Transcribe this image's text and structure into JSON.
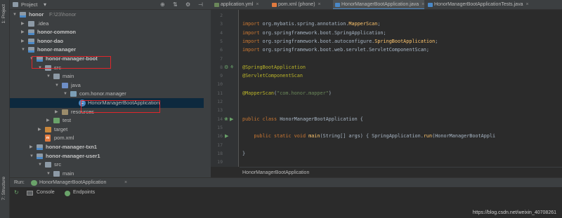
{
  "sidebar": {
    "project_tab": "1: Project",
    "structure_tab": "7: Structure"
  },
  "project_panel": {
    "title": "Project",
    "tree": [
      {
        "label": "honor",
        "extra": "F:\\23\\honor",
        "level": 0,
        "expanded": true,
        "icon": "folder-module",
        "bold": true
      },
      {
        "label": ".idea",
        "level": 1,
        "expanded": false,
        "icon": "folder"
      },
      {
        "label": "honor-common",
        "level": 1,
        "expanded": false,
        "icon": "folder-module",
        "bold": true
      },
      {
        "label": "honor-dao",
        "level": 1,
        "expanded": false,
        "icon": "folder-module",
        "bold": true
      },
      {
        "label": "honor-manager",
        "level": 1,
        "expanded": true,
        "icon": "folder-module",
        "bold": true
      },
      {
        "label": "honor-manager-boot",
        "level": 2,
        "expanded": true,
        "icon": "folder-module",
        "bold": true,
        "highlight": true
      },
      {
        "label": "src",
        "level": 3,
        "expanded": true,
        "icon": "folder"
      },
      {
        "label": "main",
        "level": 4,
        "expanded": true,
        "icon": "folder"
      },
      {
        "label": "java",
        "level": 5,
        "expanded": true,
        "icon": "folder-src"
      },
      {
        "label": "com.honor.manager",
        "level": 6,
        "expanded": true,
        "icon": "package"
      },
      {
        "label": "HonorManagerBootApplication",
        "level": 7,
        "icon": "class",
        "selected": true,
        "highlight": true
      },
      {
        "label": "resources",
        "level": 5,
        "expanded": false,
        "icon": "folder-res"
      },
      {
        "label": "test",
        "level": 4,
        "expanded": false,
        "icon": "folder-test"
      },
      {
        "label": "target",
        "level": 3,
        "expanded": false,
        "icon": "folder-orange"
      },
      {
        "label": "pom.xml",
        "level": 3,
        "icon": "xml"
      },
      {
        "label": "honor-manager-txn1",
        "level": 2,
        "expanded": false,
        "icon": "folder-module",
        "bold": true
      },
      {
        "label": "honor-manager-user1",
        "level": 2,
        "expanded": true,
        "icon": "folder-module",
        "bold": true
      },
      {
        "label": "src",
        "level": 3,
        "expanded": true,
        "icon": "folder"
      },
      {
        "label": "main",
        "level": 4,
        "expanded": true,
        "icon": "folder"
      },
      {
        "label": "java",
        "level": 5,
        "expanded": true,
        "icon": "folder-src"
      }
    ]
  },
  "editor_tabs": [
    {
      "label": "application.yml",
      "color": "#6a8759",
      "active": false
    },
    {
      "label": "pom.xml (phone)",
      "color": "#e07a3f",
      "active": false
    },
    {
      "label": "HonorManagerBootApplication.java",
      "color": "#4a88c7",
      "active": true
    },
    {
      "label": "HonorManagerBootApplicationTests.java",
      "color": "#4a88c7",
      "active": false
    }
  ],
  "editor": {
    "line_numbers": [
      "2",
      "3",
      "4",
      "5",
      "6",
      "7",
      "8",
      "9",
      "10",
      "11",
      "12",
      "13",
      "14",
      "15",
      "16",
      "17",
      "18",
      "19"
    ],
    "lines": [
      [],
      [
        [
          "kw",
          "import "
        ],
        [
          "",
          "org.mybatis.spring.annotation."
        ],
        [
          "type",
          "MapperScan"
        ],
        [
          "",
          ";"
        ]
      ],
      [
        [
          "kw",
          "import "
        ],
        [
          "",
          "org.springframework.boot.SpringApplication;"
        ]
      ],
      [
        [
          "kw",
          "import "
        ],
        [
          "",
          "org.springframework.boot.autoconfigure."
        ],
        [
          "type",
          "SpringBootApplication"
        ],
        [
          "",
          ";"
        ]
      ],
      [
        [
          "kw",
          "import "
        ],
        [
          "",
          "org.springframework.boot.web.servlet.ServletComponentScan;"
        ]
      ],
      [],
      [
        [
          "ann",
          "@SpringBootApplication"
        ]
      ],
      [
        [
          "ann",
          "@ServletComponentScan"
        ]
      ],
      [],
      [
        [
          "ann",
          "@MapperScan"
        ],
        [
          "",
          "("
        ],
        [
          "str",
          "\"com.honor.mapper\""
        ],
        [
          "",
          ")"
        ]
      ],
      [],
      [],
      [
        [
          "kw",
          "public class "
        ],
        [
          "",
          "HonorManagerBootApplication {"
        ]
      ],
      [],
      [
        [
          "",
          "    "
        ],
        [
          "kw",
          "public static void "
        ],
        [
          "type",
          "main"
        ],
        [
          "",
          "(String[] args) { SpringApplication."
        ],
        [
          "type",
          "run"
        ],
        [
          "",
          "(HonorManagerBootAppli"
        ]
      ],
      [],
      [
        [
          "",
          "}"
        ]
      ],
      []
    ],
    "breadcrumb": "HonorManagerBootApplication"
  },
  "run_bar": {
    "label": "Run:",
    "config": "HonorManagerBootApplication"
  },
  "console_bar": {
    "console": "Console",
    "endpoints": "Endpoints"
  },
  "watermark": "https://blog.csdn.net/weixin_40708261"
}
